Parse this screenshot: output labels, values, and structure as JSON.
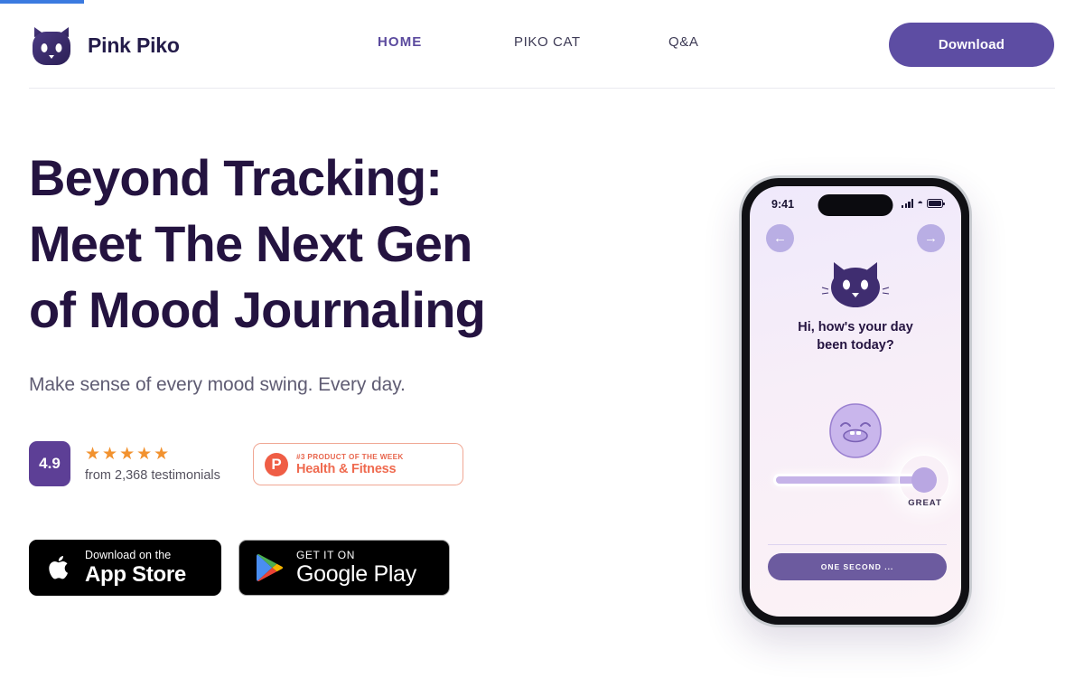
{
  "browser": {
    "loading_bar": true,
    "accent": "#3b7ae0"
  },
  "header": {
    "brand_name": "Pink Piko",
    "logo_icon": "cat-logo-icon",
    "nav": [
      {
        "label": "HOME",
        "active": true
      },
      {
        "label": "PIKO CAT",
        "active": false
      },
      {
        "label": "Q&A",
        "active": false
      }
    ],
    "cta_label": "Download",
    "cta_color": "#5d4da3"
  },
  "hero": {
    "title_line1": "Beyond Tracking:",
    "title_line2": "Meet The Next Gen",
    "title_line3": "of Mood Journaling",
    "subtitle": "Make sense of every mood swing. Every day.",
    "title_color": "#241340"
  },
  "social_proof": {
    "score": "4.9",
    "score_bg": "#5d3f96",
    "stars": "★★★★★",
    "star_color": "#f2922f",
    "testimonials": "from 2,368 testimonials",
    "product_hunt": {
      "mark": "P",
      "rank": "#3 PRODUCT OF THE WEEK",
      "category": "Health & Fitness",
      "accent": "#ef6a4f"
    }
  },
  "stores": {
    "apple": {
      "small": "Download on the",
      "big": "App Store",
      "icon": "apple-icon"
    },
    "google": {
      "small": "GET IT ON",
      "big": "Google Play",
      "icon": "google-play-icon"
    }
  },
  "phone": {
    "status_time": "9:41",
    "status_icons": [
      "signal-icon",
      "wifi-icon",
      "battery-icon"
    ],
    "back_arrow": "←",
    "forward_arrow": "→",
    "mascot_icon": "cat-face-icon",
    "prompt_line1": "Hi, how's your day",
    "prompt_line2": "been today?",
    "mood_icon": "happy-blob-icon",
    "slider_label": "GREAT",
    "slider_value": 87,
    "action_label": "ONE SECOND ...",
    "screen_gradient_start": "#efe9fb",
    "screen_gradient_end": "#fcf2f6"
  }
}
